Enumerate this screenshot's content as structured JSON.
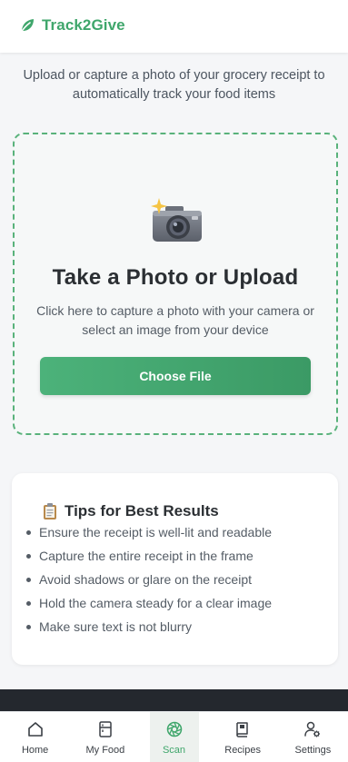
{
  "header": {
    "brand_name": "Track2Give",
    "brand_color": "#3fa66b"
  },
  "intro": {
    "subtitle": "Upload or capture a photo of your grocery receipt to automatically track your food items"
  },
  "upload": {
    "icon": "camera-icon",
    "title": "Take a Photo or Upload",
    "description": "Click here to capture a photo with your camera or select an image from your device",
    "button_label": "Choose File"
  },
  "tips": {
    "icon": "clipboard-icon",
    "title": "Tips for Best Results",
    "items": [
      "Ensure the receipt is well-lit and readable",
      "Capture the entire receipt in the frame",
      "Avoid shadows or glare on the receipt",
      "Hold the camera steady for a clear image",
      "Make sure text is not blurry"
    ]
  },
  "nav": {
    "items": [
      {
        "label": "Home",
        "icon": "home-icon"
      },
      {
        "label": "My Food",
        "icon": "fridge-icon"
      },
      {
        "label": "Scan",
        "icon": "aperture-icon",
        "active": true
      },
      {
        "label": "Recipes",
        "icon": "book-icon"
      },
      {
        "label": "Settings",
        "icon": "user-gear-icon"
      }
    ]
  },
  "colors": {
    "accent": "#3fa66b",
    "dropzone_border": "#59b27b",
    "button_gradient_start": "#4cb27a",
    "button_gradient_end": "#3b9a65"
  }
}
